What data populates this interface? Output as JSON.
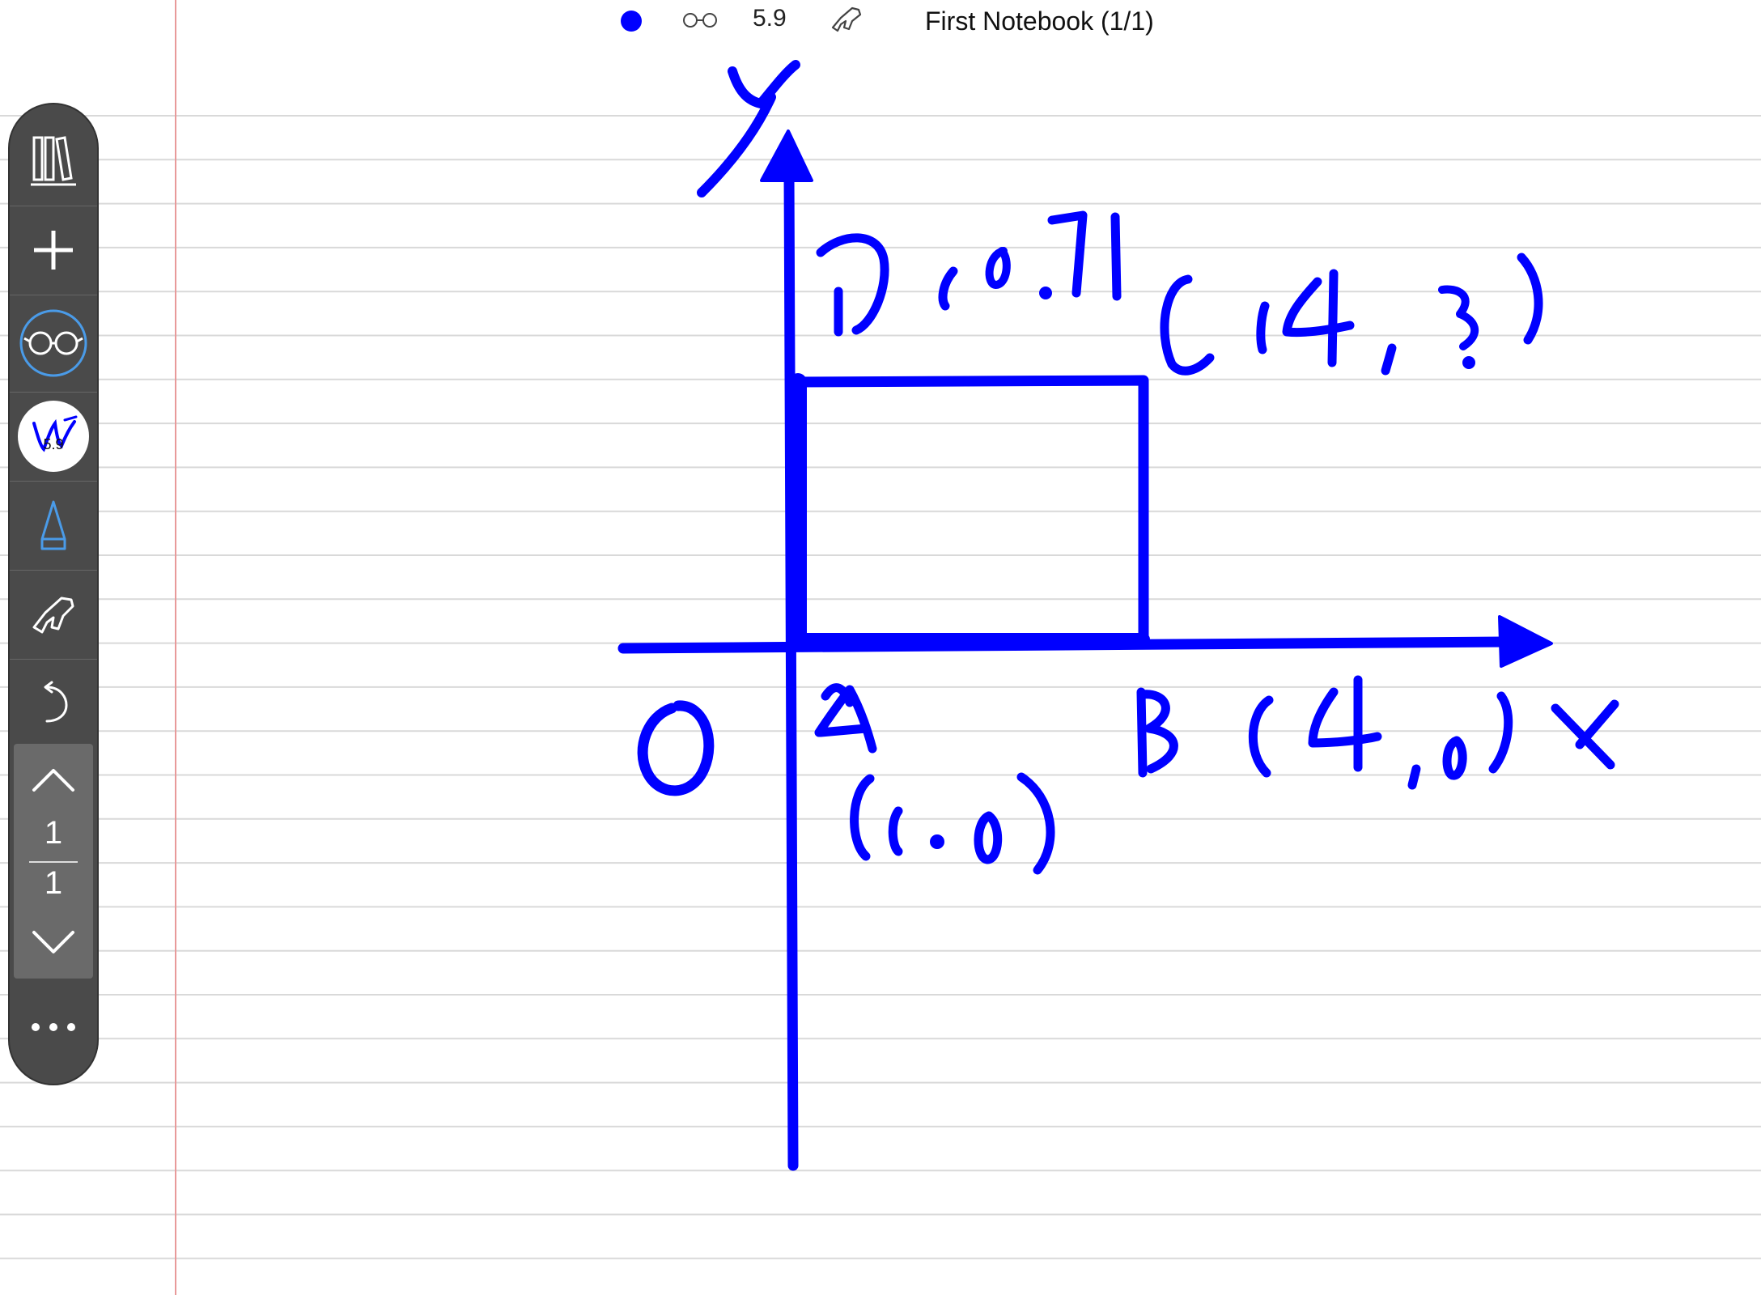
{
  "topbar": {
    "pen_color": "#0000ff",
    "size_value": "5.9",
    "notebook_title": "First Notebook (1/1)"
  },
  "toolbar": {
    "icons": [
      "library-icon",
      "plus-icon",
      "glasses-icon",
      "pen-badge-icon",
      "pencil-icon",
      "hand-icon",
      "undo-icon",
      "chevron-up-icon",
      "chevron-down-icon",
      "more-icon"
    ],
    "pen_badge_value": "5.9",
    "page_current": "1",
    "page_total": "1"
  },
  "canvas": {
    "ink_color": "#0000ff",
    "paper_line_color": "#d9d9d9",
    "margin_line_color": "#e89a9a"
  }
}
